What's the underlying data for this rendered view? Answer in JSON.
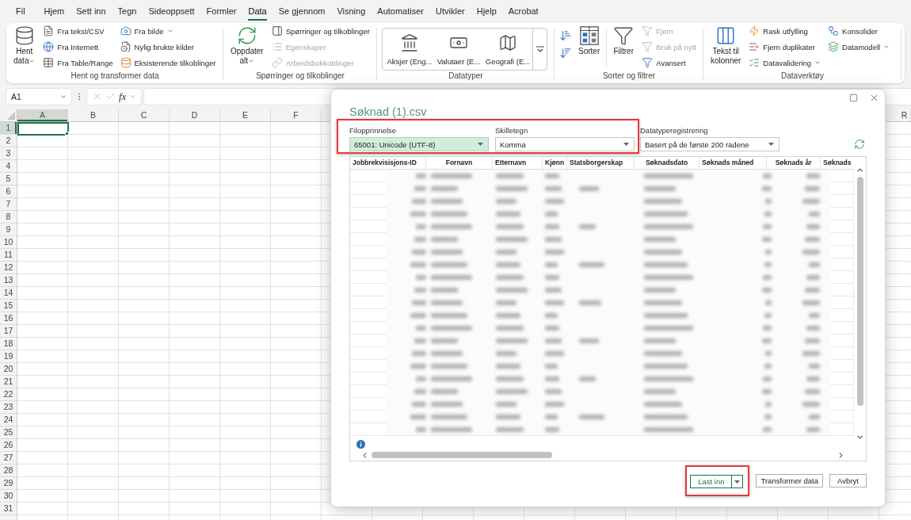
{
  "tabs": [
    {
      "label": "Fil",
      "selected": false
    },
    {
      "label": "Hjem",
      "selected": false
    },
    {
      "label": "Sett inn",
      "selected": false
    },
    {
      "label": "Tegn",
      "selected": false
    },
    {
      "label": "Sideoppsett",
      "selected": false
    },
    {
      "label": "Formler",
      "selected": false
    },
    {
      "label": "Data",
      "selected": true
    },
    {
      "label": "Se gjennom",
      "selected": false
    },
    {
      "label": "Visning",
      "selected": false
    },
    {
      "label": "Automatiser",
      "selected": false
    },
    {
      "label": "Utvikler",
      "selected": false
    },
    {
      "label": "Hjelp",
      "selected": false
    },
    {
      "label": "Acrobat",
      "selected": false
    }
  ],
  "ribbon": {
    "groups": [
      {
        "label": "Hent og transformer data",
        "columns": [
          {
            "kind": "large",
            "items": [
              {
                "label": "Hent data",
                "dropdown": true,
                "disabled": false
              }
            ]
          },
          {
            "kind": "stack",
            "items": [
              {
                "label": "Fra tekst/CSV",
                "dropdown": false,
                "disabled": false
              },
              {
                "label": "Fra Internett",
                "dropdown": false,
                "disabled": false
              },
              {
                "label": "Fra Table/Range",
                "dropdown": false,
                "disabled": false
              }
            ]
          },
          {
            "kind": "stack",
            "items": [
              {
                "label": "Fra bilde",
                "dropdown": true,
                "disabled": false
              },
              {
                "label": "Nylig brukte kilder",
                "dropdown": false,
                "disabled": false
              },
              {
                "label": "Eksisterende tilkoblinger",
                "dropdown": false,
                "disabled": false
              }
            ]
          }
        ]
      },
      {
        "label": "Spørringer og tilkoblinger",
        "columns": [
          {
            "kind": "large",
            "items": [
              {
                "label": "Oppdater alt",
                "dropdown": true,
                "disabled": false
              }
            ]
          },
          {
            "kind": "stack",
            "items": [
              {
                "label": "Spørringer og tilkoblinger",
                "dropdown": false,
                "disabled": false
              },
              {
                "label": "Egenskaper",
                "dropdown": false,
                "disabled": true
              },
              {
                "label": "Arbeidsbokkoblinger",
                "dropdown": false,
                "disabled": true
              }
            ]
          }
        ]
      },
      {
        "label": "Datatyper",
        "columns": [
          {
            "kind": "gallery",
            "items": [
              {
                "label": "Aksjer (Eng..."
              },
              {
                "label": "Valutaer (E..."
              },
              {
                "label": "Geografi (E..."
              }
            ]
          }
        ]
      },
      {
        "label": "Sorter og filtrer",
        "columns": [
          {
            "kind": "sort_pair"
          },
          {
            "kind": "large",
            "items": [
              {
                "label": "Sorter",
                "dropdown": false,
                "disabled": false
              }
            ]
          },
          {
            "kind": "separator"
          },
          {
            "kind": "large",
            "items": [
              {
                "label": "Filtrer",
                "dropdown": false,
                "disabled": false
              }
            ]
          },
          {
            "kind": "stack",
            "items": [
              {
                "label": "Fjern",
                "dropdown": false,
                "disabled": true
              },
              {
                "label": "Bruk på nytt",
                "dropdown": false,
                "disabled": true
              },
              {
                "label": "Avansert",
                "dropdown": false,
                "disabled": false
              }
            ]
          }
        ]
      },
      {
        "label": "Dataverktøy",
        "columns": [
          {
            "kind": "large",
            "items": [
              {
                "label": "Tekst til kolonner",
                "dropdown": false,
                "disabled": false
              }
            ]
          },
          {
            "kind": "stack",
            "items": [
              {
                "label": "Rask utfylling",
                "dropdown": false,
                "disabled": false
              },
              {
                "label": "Fjern duplikater",
                "dropdown": false,
                "disabled": false
              },
              {
                "label": "Datavalidering",
                "dropdown": true,
                "disabled": false
              }
            ]
          },
          {
            "kind": "stack",
            "items": [
              {
                "label": "Konsolider",
                "dropdown": false,
                "disabled": false
              },
              {
                "label": "Datamodell",
                "dropdown": true,
                "disabled": false
              }
            ]
          }
        ]
      }
    ]
  },
  "formula_bar": {
    "name_box": "A1",
    "function_label": "fx"
  },
  "sheet": {
    "columns": [
      {
        "label": "A",
        "selected": true
      },
      {
        "label": "B",
        "selected": false
      },
      {
        "label": "C",
        "selected": false
      },
      {
        "label": "D",
        "selected": false
      },
      {
        "label": "E",
        "selected": false
      },
      {
        "label": "F",
        "selected": false
      }
    ],
    "columns_right": [
      {
        "label": "R",
        "selected": false
      }
    ],
    "rows": [
      {
        "label": "1",
        "selected": true
      },
      {
        "label": "2",
        "selected": false
      },
      {
        "label": "3",
        "selected": false
      },
      {
        "label": "4",
        "selected": false
      },
      {
        "label": "5",
        "selected": false
      },
      {
        "label": "6",
        "selected": false
      },
      {
        "label": "7",
        "selected": false
      },
      {
        "label": "8",
        "selected": false
      },
      {
        "label": "9",
        "selected": false
      },
      {
        "label": "10",
        "selected": false
      },
      {
        "label": "11",
        "selected": false
      },
      {
        "label": "12",
        "selected": false
      },
      {
        "label": "13",
        "selected": false
      },
      {
        "label": "14",
        "selected": false
      },
      {
        "label": "15",
        "selected": false
      },
      {
        "label": "16",
        "selected": false
      },
      {
        "label": "17",
        "selected": false
      },
      {
        "label": "18",
        "selected": false
      },
      {
        "label": "19",
        "selected": false
      },
      {
        "label": "20",
        "selected": false
      },
      {
        "label": "21",
        "selected": false
      },
      {
        "label": "22",
        "selected": false
      },
      {
        "label": "23",
        "selected": false
      },
      {
        "label": "24",
        "selected": false
      },
      {
        "label": "25",
        "selected": false
      },
      {
        "label": "26",
        "selected": false
      },
      {
        "label": "27",
        "selected": false
      },
      {
        "label": "28",
        "selected": false
      },
      {
        "label": "29",
        "selected": false
      },
      {
        "label": "30",
        "selected": false
      },
      {
        "label": "31",
        "selected": false
      }
    ]
  },
  "dialog": {
    "title": "Søknad (1).csv",
    "options": [
      {
        "label": "Filopprinnelse",
        "value": "65001: Unicode (UTF-8)",
        "focused": true,
        "highlighted": true
      },
      {
        "label": "Skilletegn",
        "value": "Komma",
        "focused": false,
        "highlighted": true
      },
      {
        "label": "Datatyperegistrering",
        "value": "Basert på de første 200 radene",
        "focused": false,
        "highlighted": false
      }
    ],
    "preview": {
      "columns": [
        "Jobbrekvisisjons-ID",
        "Fornavn",
        "Etternavn",
        "Kjønn",
        "Statsborgerskap",
        "Søknadsdato",
        "Søknads måned",
        "Søknads år",
        "Søknads"
      ]
    },
    "buttons": [
      {
        "label": "Last inn",
        "kind": "split",
        "default": true,
        "highlighted": true
      },
      {
        "label": "Transformer data",
        "kind": "plain",
        "default": false,
        "highlighted": false
      },
      {
        "label": "Avbryt",
        "kind": "plain",
        "default": false,
        "highlighted": false
      }
    ]
  }
}
